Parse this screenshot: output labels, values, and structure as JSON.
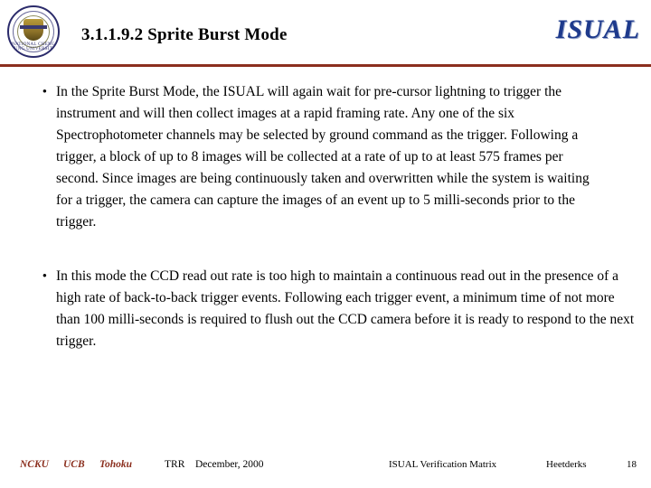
{
  "header": {
    "title": "3.1.1.9.2   Sprite Burst Mode",
    "logo_text": "ISUAL",
    "seal_label": "NATIONAL CHENG KUNG UNIVERSITY",
    "seal_icon": "university-seal-icon",
    "rule_color": "#8b2f1e",
    "logo_color": "#1e3a8c"
  },
  "content": {
    "bullets": [
      {
        "marker": "•",
        "text": "In the Sprite Burst Mode, the ISUAL will again wait for pre-cursor lightning to trigger the instrument and will then collect images at a rapid framing rate. Any one of the six Spectrophotometer channels may be selected by ground command as the trigger.   Following a trigger,  a block of up to 8 images will be collected at a rate of  up to at least 575  frames per second.  Since images are being continuously taken and overwritten while the system is waiting for a trigger,  the camera can capture the images of an event up to 5 milli-seconds prior to the trigger."
      },
      {
        "marker": "•",
        "text": "In this mode the CCD read out rate is too high to maintain a continuous read out in the presence of a high rate of back-to-back trigger events. Following each trigger event, a minimum time of not more than 100 milli-seconds is required to flush out the CCD camera before it is ready to respond to the next trigger."
      }
    ]
  },
  "footer": {
    "org1": "NCKU",
    "org2": "UCB",
    "org3": "Tohoku",
    "doc": "TRR",
    "date": "December,  2000",
    "center": "ISUAL Verification Matrix",
    "author": "Heetderks",
    "page": "18"
  }
}
